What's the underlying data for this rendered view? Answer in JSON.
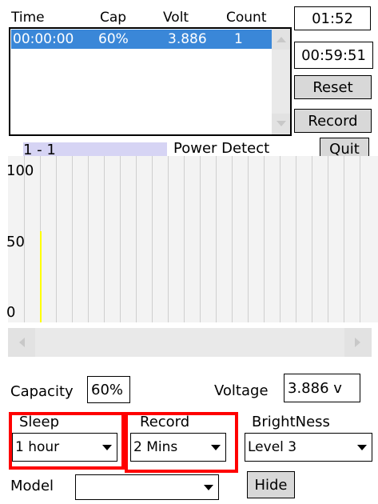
{
  "list": {
    "headers": [
      "Time",
      "Cap",
      "Volt",
      "Count"
    ],
    "rows": [
      {
        "time": "00:00:00",
        "cap": "60%",
        "volt": "3.886",
        "count": "1"
      }
    ]
  },
  "times": {
    "elapsed": "01:52",
    "remaining": "00:59:51"
  },
  "buttons": {
    "reset": "Reset",
    "record": "Record",
    "quit": "Quit",
    "hide": "Hide"
  },
  "chart": {
    "legend_label": "1 - 1",
    "title": "Power Detect",
    "y_ticks": [
      "100",
      "50",
      "0"
    ]
  },
  "chart_data": {
    "type": "line",
    "title": "Power Detect",
    "series": [
      {
        "name": "1 - 1",
        "values": [
          60
        ]
      }
    ],
    "ylim": [
      0,
      100
    ],
    "yticks": [
      0,
      50,
      100
    ],
    "grid": true
  },
  "readouts": {
    "capacity_label": "Capacity",
    "capacity_value": "60%",
    "voltage_label": "Voltage",
    "voltage_value": "3.886 v"
  },
  "settings": {
    "sleep_label": "Sleep",
    "sleep_value": "1 hour",
    "record_label": "Record",
    "record_value": "2 Mins",
    "brightness_label": "BrightNess",
    "brightness_value": "Level 3",
    "model_label": "Model",
    "model_value": ""
  },
  "colors": {
    "selection": "#3a87d8",
    "legend_swatch": "#d6d4f4",
    "series_line": "#ffff00",
    "highlight_box": "#ff0000"
  }
}
